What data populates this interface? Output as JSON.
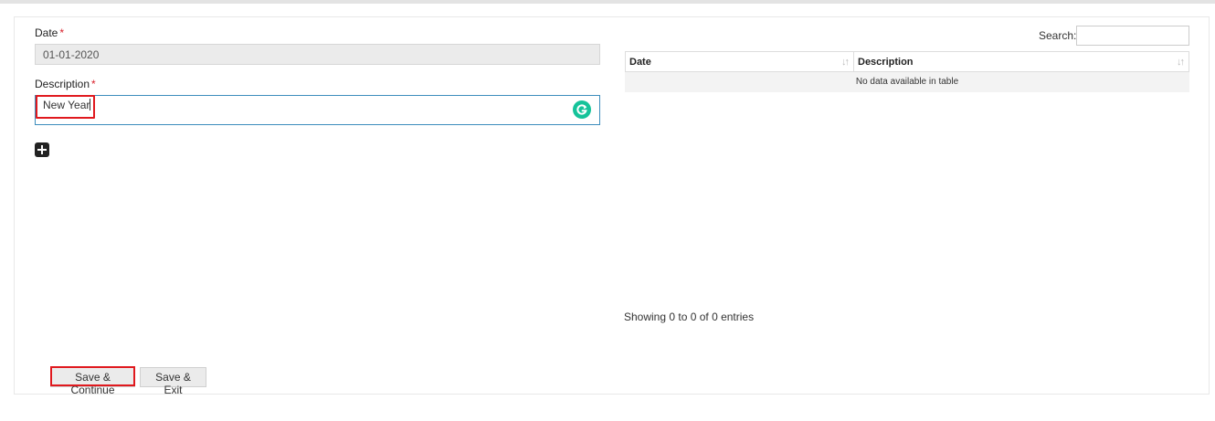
{
  "form": {
    "date_label": "Date",
    "date_required": "*",
    "date_value": "01-01-2020",
    "description_label": "Description",
    "description_required": "*",
    "description_value": "New Year",
    "grammarly_icon": "grammarly-icon",
    "add_icon": "plus-square-icon"
  },
  "table": {
    "search_label": "Search:",
    "search_value": "",
    "columns": [
      "Date",
      "Description"
    ],
    "sort_icon": "sort-icon",
    "empty_message": "No data available in table",
    "info": "Showing 0 to 0 of 0 entries"
  },
  "buttons": {
    "save_continue": "Save & Continue",
    "save_exit": "Save & Exit"
  },
  "colors": {
    "accent_border": "#3c8dbc",
    "highlight": "#e0191e",
    "grammarly": "#15c39a"
  }
}
